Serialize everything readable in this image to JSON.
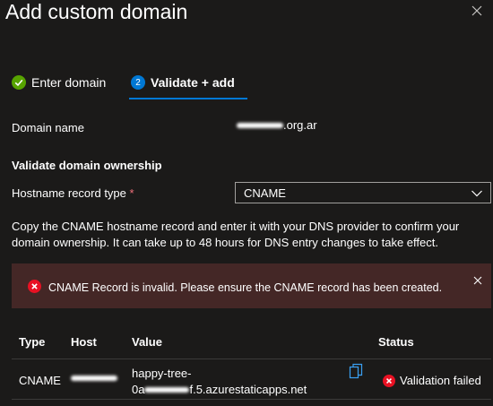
{
  "panel": {
    "title": "Add custom domain"
  },
  "steps": [
    {
      "label": "Enter domain",
      "state": "completed"
    },
    {
      "number": "2",
      "label": "Validate + add",
      "state": "current"
    }
  ],
  "domain": {
    "label": "Domain name",
    "value_visible_suffix": ".org.ar"
  },
  "validation": {
    "heading": "Validate domain ownership",
    "record_type_label": "Hostname record type",
    "required_marker": "*",
    "record_type_value": "CNAME",
    "instructions": "Copy the CNAME hostname record and enter it with your DNS provider to confirm your domain ownership. It can take up to 48 hours for DNS entry changes to take effect."
  },
  "error": {
    "message": "CNAME Record is invalid.  Please ensure the CNAME record has been created."
  },
  "table": {
    "columns": [
      "Type",
      "Host",
      "Value",
      "Status"
    ],
    "rows": [
      {
        "type": "CNAME",
        "value_line1": "happy-tree-",
        "value_line2_prefix": "0a",
        "value_line2_suffix": "f.5.azurestaticapps.net",
        "status": "Validation failed"
      }
    ]
  },
  "colors": {
    "background": "#1b1a19",
    "accent": "#0078d4",
    "success": "#57a300",
    "error": "#e81123",
    "error_banner": "#442726"
  }
}
